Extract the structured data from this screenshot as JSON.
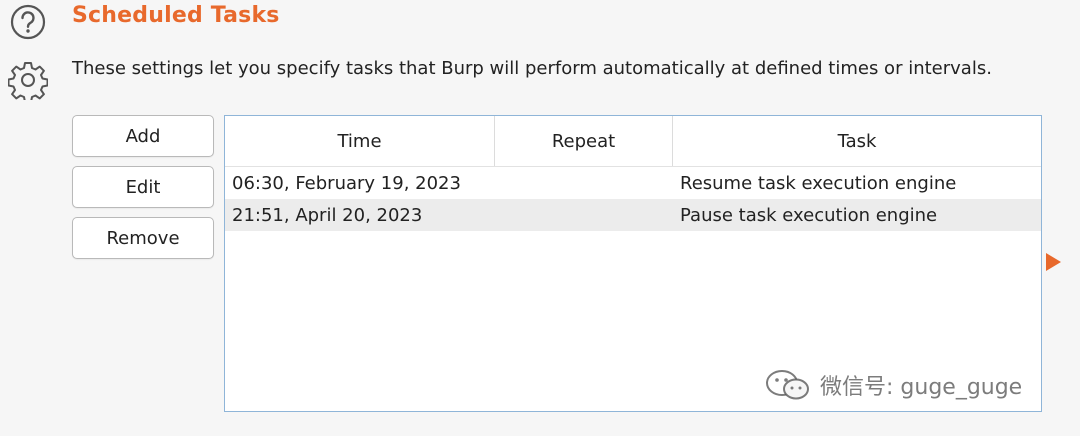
{
  "header": {
    "title": "Scheduled Tasks",
    "description": "These settings let you specify tasks that Burp will perform automatically at defined times or intervals."
  },
  "buttons": {
    "add": "Add",
    "edit": "Edit",
    "remove": "Remove"
  },
  "table": {
    "columns": [
      "Time",
      "Repeat",
      "Task"
    ],
    "rows": [
      {
        "time": "06:30, February 19, 2023",
        "repeat": "",
        "task": "Resume task execution engine"
      },
      {
        "time": "21:51, April 20, 2023",
        "repeat": "",
        "task": "Pause task execution engine"
      }
    ]
  },
  "watermark": {
    "text": "微信号: guge_guge"
  },
  "icons": {
    "help": "help-icon",
    "settings": "gear-icon",
    "expand": "arrow-right-icon",
    "watermark": "wechat-icon"
  },
  "colors": {
    "accent": "#e8692c",
    "table_border": "#8fb5d8",
    "selected_row": "#ececec"
  }
}
